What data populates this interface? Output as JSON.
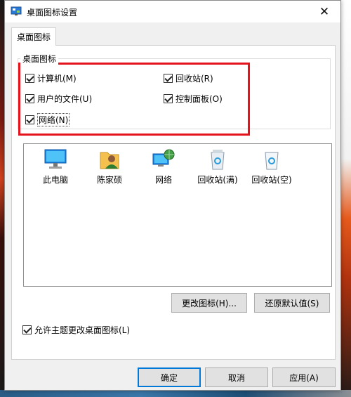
{
  "window": {
    "title": "桌面图标设置",
    "close_glyph": "✕"
  },
  "tabs": [
    {
      "label": "桌面图标"
    }
  ],
  "group": {
    "label": "桌面图标",
    "checkboxes": [
      {
        "label": "计算机(M)",
        "checked": true
      },
      {
        "label": "回收站(R)",
        "checked": true
      },
      {
        "label": "用户的文件(U)",
        "checked": true
      },
      {
        "label": "控制面板(O)",
        "checked": true
      },
      {
        "label": "网络(N)",
        "checked": true
      }
    ]
  },
  "icons": [
    {
      "label": "此电脑",
      "icon": "computer-icon"
    },
    {
      "label": "陈家硕",
      "icon": "user-folder-icon"
    },
    {
      "label": "网络",
      "icon": "network-icon"
    },
    {
      "label": "回收站(满)",
      "icon": "recycle-bin-full-icon"
    },
    {
      "label": "回收站(空)",
      "icon": "recycle-bin-empty-icon"
    }
  ],
  "buttons": {
    "change_icon": "更改图标(H)...",
    "restore_default": "还原默认值(S)",
    "ok": "确定",
    "cancel": "取消",
    "apply": "应用(A)"
  },
  "allow_themes": {
    "label": "允许主题更改桌面图标(L)",
    "checked": true
  },
  "colors": {
    "highlight": "#e5141c",
    "accent": "#0078d7"
  }
}
